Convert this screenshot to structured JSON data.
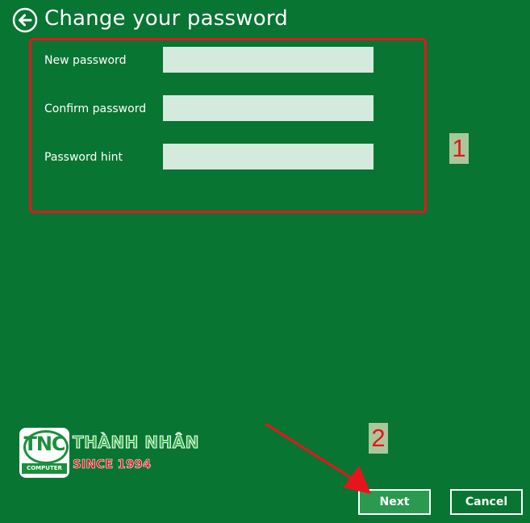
{
  "header": {
    "title": "Change your password",
    "back_icon": "back-arrow-icon"
  },
  "form": {
    "fields": [
      {
        "label": "New password",
        "value": ""
      },
      {
        "label": "Confirm password",
        "value": ""
      },
      {
        "label": "Password hint",
        "value": ""
      }
    ]
  },
  "annotations": {
    "step1": "1",
    "step2": "2",
    "highlight_color": "#e8141b"
  },
  "logo": {
    "emblem": "TNC",
    "emblem_sub": "COMPUTER",
    "name": "THÀNH NHÂN",
    "since": "SINCE 1994"
  },
  "buttons": {
    "next": "Next",
    "cancel": "Cancel"
  },
  "colors": {
    "background": "#087532",
    "input_fill": "#d3eadd",
    "next_fill": "#2a9a51",
    "badge_fill": "#a9c79a"
  }
}
